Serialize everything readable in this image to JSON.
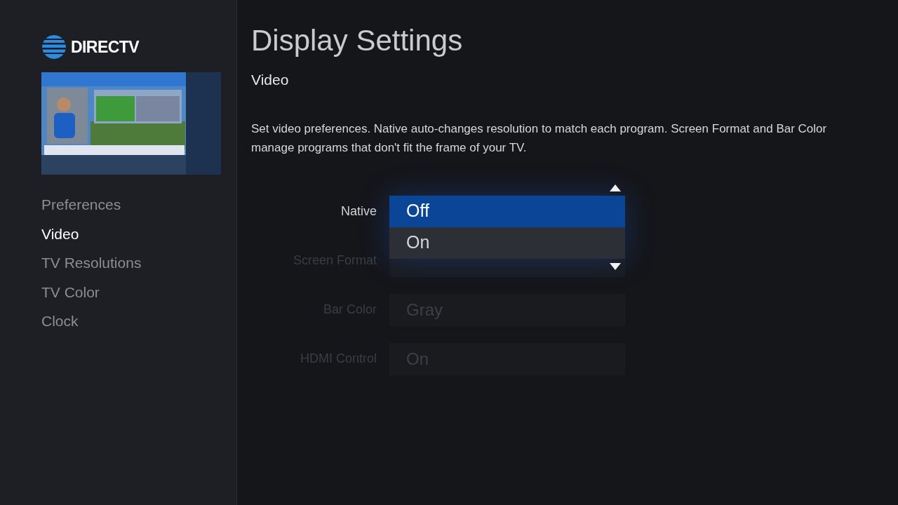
{
  "logo": {
    "text": "DIRECTV"
  },
  "menu": [
    {
      "label": "Preferences",
      "selected": false
    },
    {
      "label": "Video",
      "selected": true
    },
    {
      "label": "TV Resolutions",
      "selected": false
    },
    {
      "label": "TV Color",
      "selected": false
    },
    {
      "label": "Clock",
      "selected": false
    }
  ],
  "header": {
    "title": "Display Settings",
    "section": "Video"
  },
  "description": "Set video preferences. Native auto-changes resolution to match each program. Screen Format and Bar Color manage programs that don't fit the frame of your TV.",
  "settings": [
    {
      "label": "Native",
      "dimmed": false,
      "open": true,
      "options": [
        {
          "label": "Off",
          "selected": true
        },
        {
          "label": "On",
          "selected": false
        }
      ]
    },
    {
      "label": "Screen Format",
      "dimmed": true,
      "open": false
    },
    {
      "label": "Bar Color",
      "value": "Gray",
      "dimmed": true,
      "open": false
    },
    {
      "label": "HDMI Control",
      "value": "On",
      "dimmed": true,
      "open": false
    }
  ]
}
